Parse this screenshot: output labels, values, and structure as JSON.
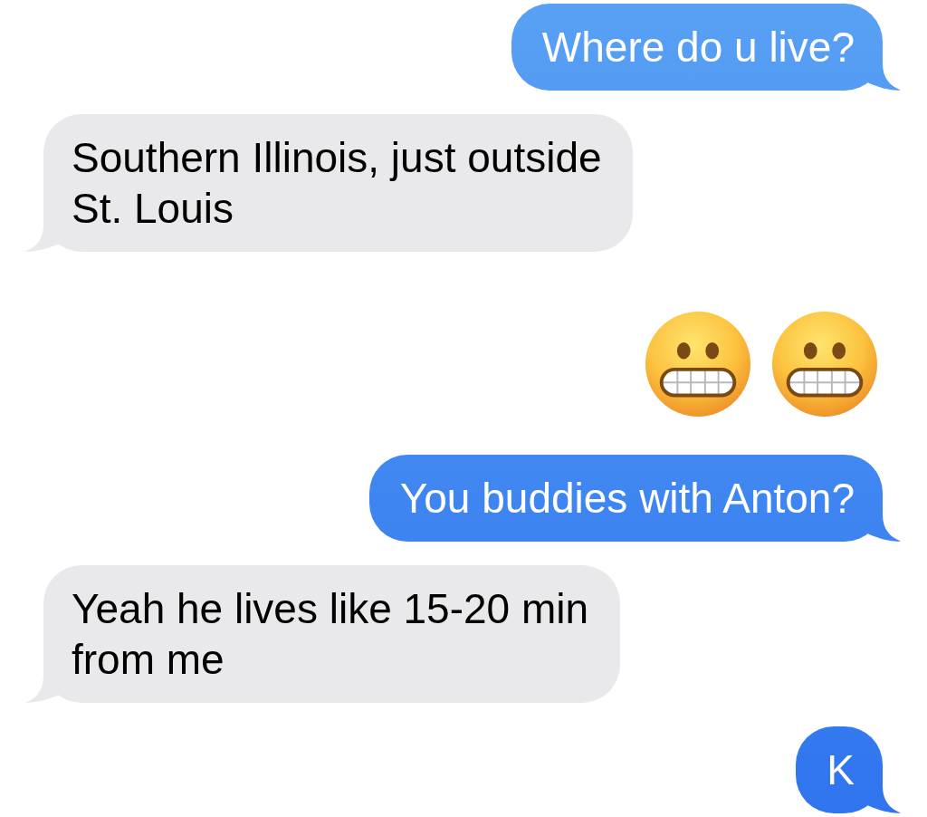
{
  "messages": [
    {
      "outgoing": true,
      "kind": "text",
      "text": "Where do u live?"
    },
    {
      "outgoing": false,
      "kind": "text",
      "text": "Southern Illinois, just outside St. Louis"
    },
    {
      "outgoing": true,
      "kind": "emoji",
      "emojis": [
        {
          "kind": "grimacing"
        },
        {
          "kind": "grimacing"
        }
      ]
    },
    {
      "outgoing": true,
      "kind": "text",
      "text": "You buddies with Anton?"
    },
    {
      "outgoing": false,
      "kind": "text",
      "text": "Yeah he lives like 15-20 min from me"
    },
    {
      "outgoing": true,
      "kind": "text",
      "text": "K"
    }
  ]
}
